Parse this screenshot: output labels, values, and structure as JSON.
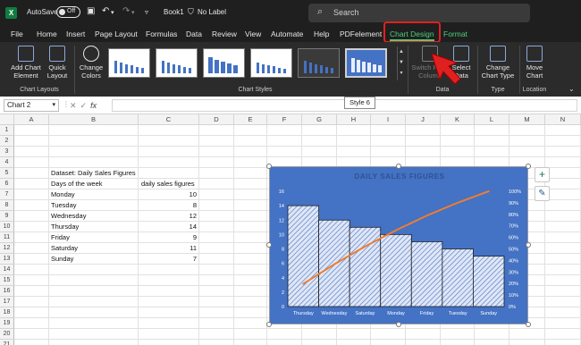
{
  "window": {
    "autosave_label": "AutoSave",
    "autosave_state": "Off",
    "book_name": "Book1",
    "label_status": "No Label",
    "search_placeholder": "Search"
  },
  "tabs": [
    {
      "label": "File"
    },
    {
      "label": "Home"
    },
    {
      "label": "Insert"
    },
    {
      "label": "Page Layout"
    },
    {
      "label": "Formulas"
    },
    {
      "label": "Data"
    },
    {
      "label": "Review"
    },
    {
      "label": "View"
    },
    {
      "label": "Automate"
    },
    {
      "label": "Help"
    },
    {
      "label": "PDFelement"
    },
    {
      "label": "Chart Design"
    },
    {
      "label": "Format"
    }
  ],
  "ribbon": {
    "add_chart_element": [
      "Add Chart",
      "Element"
    ],
    "quick_layout": [
      "Quick",
      "Layout"
    ],
    "chart_layouts_group": "Chart Layouts",
    "change_colors": [
      "Change",
      "Colors"
    ],
    "chart_styles_group": "Chart Styles",
    "switch_row_column": [
      "Switch Row/",
      "Column"
    ],
    "select_data": [
      "Select",
      "Data"
    ],
    "data_group": "Data",
    "change_chart_type": [
      "Change",
      "Chart Type"
    ],
    "type_group": "Type",
    "move_chart": [
      "Move",
      "Chart"
    ],
    "location_group": "Location",
    "tooltip": "Style 6"
  },
  "formula_bar": {
    "name_box": "Chart 2",
    "cancel_symbol": "✕",
    "enter_symbol": "✓",
    "fx_label": "fx",
    "formula": ""
  },
  "grid": {
    "columns": [
      "A",
      "B",
      "C",
      "D",
      "E",
      "F",
      "G",
      "H",
      "I",
      "J",
      "K",
      "L",
      "M",
      "N"
    ],
    "rows": [
      "1",
      "2",
      "3",
      "4",
      "5",
      "6",
      "7",
      "8",
      "9",
      "10",
      "11",
      "12",
      "13",
      "14",
      "15",
      "16",
      "17",
      "18",
      "19",
      "20",
      "21"
    ]
  },
  "sheet": {
    "title": "Dataset: Daily Sales Figures",
    "header_col1": "Days of the week",
    "header_col2": "daily sales figures",
    "rows": [
      {
        "day": "Monday",
        "sales": "10"
      },
      {
        "day": "Tuesday",
        "sales": "8"
      },
      {
        "day": "Wednesday",
        "sales": "12"
      },
      {
        "day": "Thursday",
        "sales": "14"
      },
      {
        "day": "Friday",
        "sales": "9"
      },
      {
        "day": "Saturday",
        "sales": "11"
      },
      {
        "day": "Sunday",
        "sales": "7"
      }
    ]
  },
  "colors": {
    "chart_background": "#4472c4",
    "bar_fill": "#dfe6f5",
    "pareto_line": "#ed7d31",
    "accent_green": "#4ccf7a",
    "highlight_red": "#e02020"
  },
  "chart_data": {
    "type": "bar",
    "title": "DAILY SALES FIGURES",
    "categories": [
      "Thursday",
      "Wednesday",
      "Saturday",
      "Monday",
      "Friday",
      "Tuesday",
      "Sunday"
    ],
    "series": [
      {
        "values": [
          14,
          12,
          11,
          10,
          9,
          8,
          7
        ],
        "axis": "left"
      },
      {
        "type": "line",
        "values": [
          19.7,
          36.6,
          52.1,
          66.2,
          78.9,
          90.1,
          100
        ],
        "axis": "right",
        "unit": "%"
      }
    ],
    "yticks_left": [
      "0",
      "2",
      "4",
      "6",
      "8",
      "10",
      "12",
      "14",
      "16"
    ],
    "yticks_right": [
      "0%",
      "10%",
      "20%",
      "30%",
      "40%",
      "50%",
      "60%",
      "70%",
      "80%",
      "90%",
      "100%"
    ],
    "ylim_left": [
      0,
      16
    ],
    "ylim_right": [
      0,
      100
    ],
    "legend": "none",
    "grid": false
  }
}
